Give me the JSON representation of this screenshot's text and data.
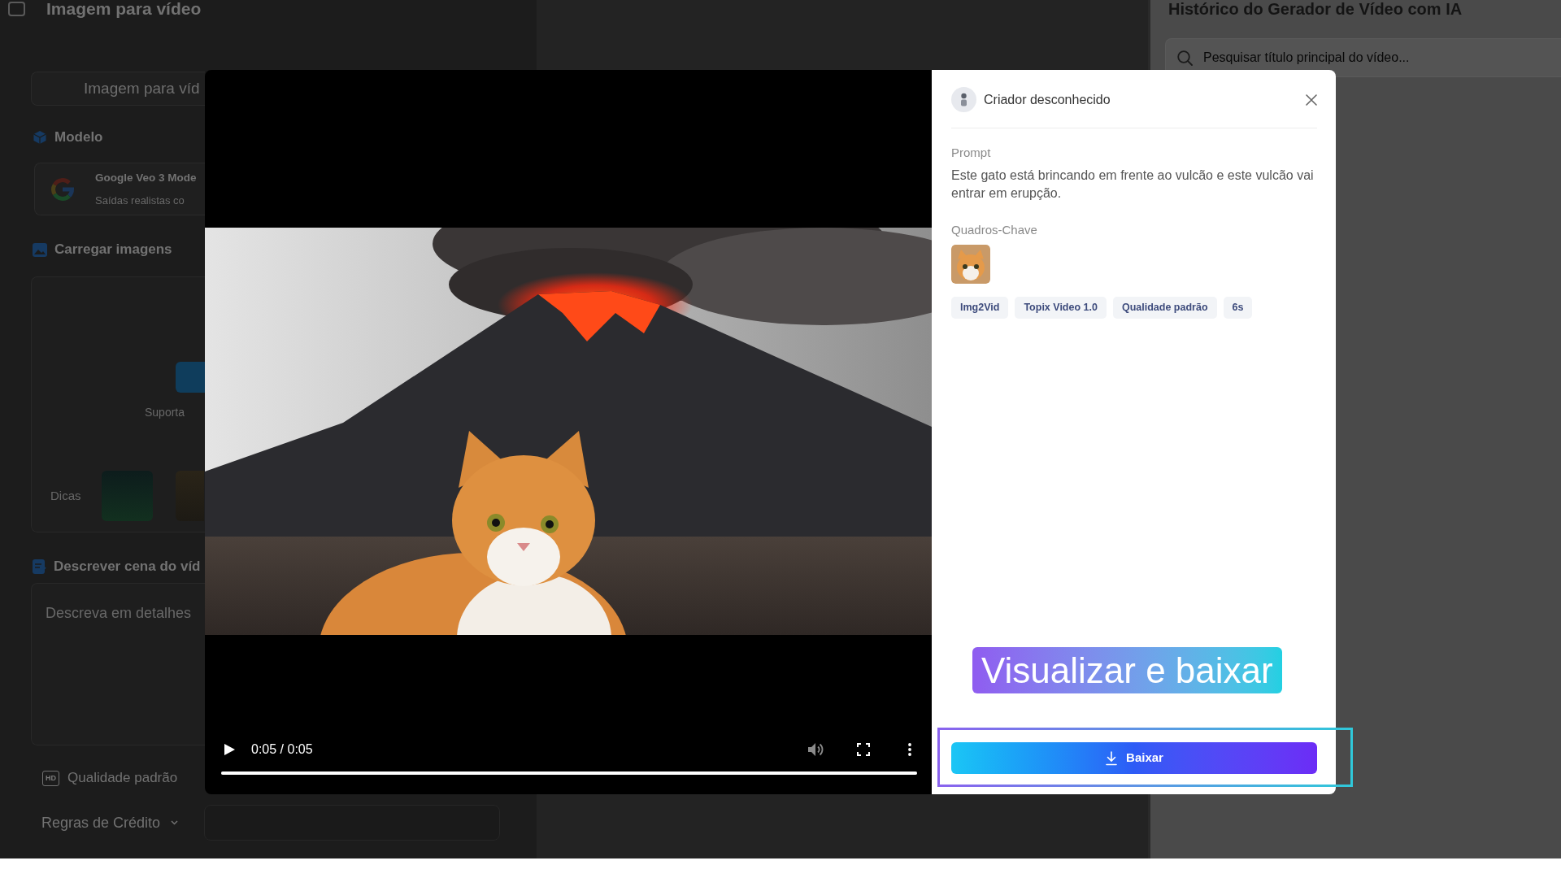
{
  "left_panel": {
    "title": "Imagem para vídeo",
    "mode_tab": {
      "label": "Imagem para víd"
    },
    "model_section": {
      "heading": "Modelo",
      "model_name": "Google Veo 3 Mode",
      "model_description": "Saídas realistas co"
    },
    "upload_section": {
      "heading": "Carregar imagens",
      "support_text": "Suporta",
      "tips_label": "Dicas"
    },
    "describe_section": {
      "heading": "Descrever cena do víd",
      "placeholder": "Descreva em detalhes"
    },
    "quality": {
      "badge": "HD",
      "label": "Qualidade padrão"
    },
    "credit_rules": {
      "label": "Regras de Crédito"
    }
  },
  "history_panel": {
    "title": "Histórico do Gerador de Vídeo com IA",
    "search": {
      "placeholder": "Pesquisar título principal do vídeo..."
    }
  },
  "video_modal": {
    "player": {
      "time": "0:05 / 0:05",
      "level": 1,
      "volume_disabled": true
    },
    "details": {
      "creator": "Criador desconhecido",
      "prompt_label": "Prompt",
      "prompt": "Este gato está brincando em frente ao vulcão e este vulcão vai entrar em erupção.",
      "keyframes_label": "Quadros-Chave",
      "tags": [
        "Img2Vid",
        "Topix Video 1.0",
        "Qualidade padrão",
        "6s"
      ],
      "download_button": {
        "label": "Baixar"
      }
    }
  },
  "annotation": {
    "label": "Visualizar e baixar"
  }
}
